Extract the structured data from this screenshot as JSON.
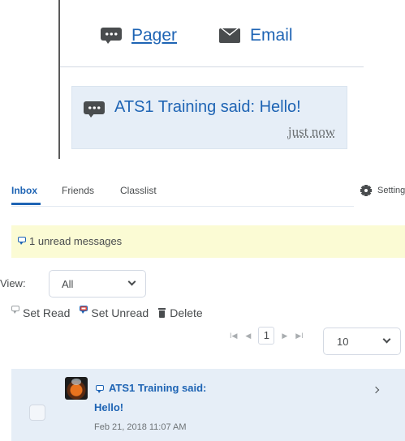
{
  "top": {
    "links": [
      {
        "label": "Pager",
        "icon": "chat-bubble-icon"
      },
      {
        "label": "Email",
        "icon": "envelope-icon"
      }
    ],
    "notification": {
      "text": "ATS1 Training said: Hello!",
      "time": "just now"
    }
  },
  "tabs": [
    {
      "label": "Inbox",
      "active": true
    },
    {
      "label": "Friends",
      "active": false
    },
    {
      "label": "Classlist",
      "active": false
    }
  ],
  "settings_label": "Setting",
  "unread_banner": "1 unread messages",
  "view": {
    "label": "View:",
    "selected": "All"
  },
  "actions": {
    "set_read": "Set Read",
    "set_unread": "Set Unread",
    "delete": "Delete"
  },
  "pager": {
    "first": "I◀",
    "prev": "◀",
    "page": "1",
    "next": "▶",
    "last": "▶I",
    "per_page": "10"
  },
  "messages": [
    {
      "from": "ATS1 Training said:",
      "subject": "Hello!",
      "date": "Feb 21, 2018 11:07 AM"
    }
  ],
  "colors": {
    "link_blue": "#1e64b4",
    "card_bg": "#e6eef7",
    "banner_bg": "#fbfbd4",
    "text": "#494c4e"
  }
}
